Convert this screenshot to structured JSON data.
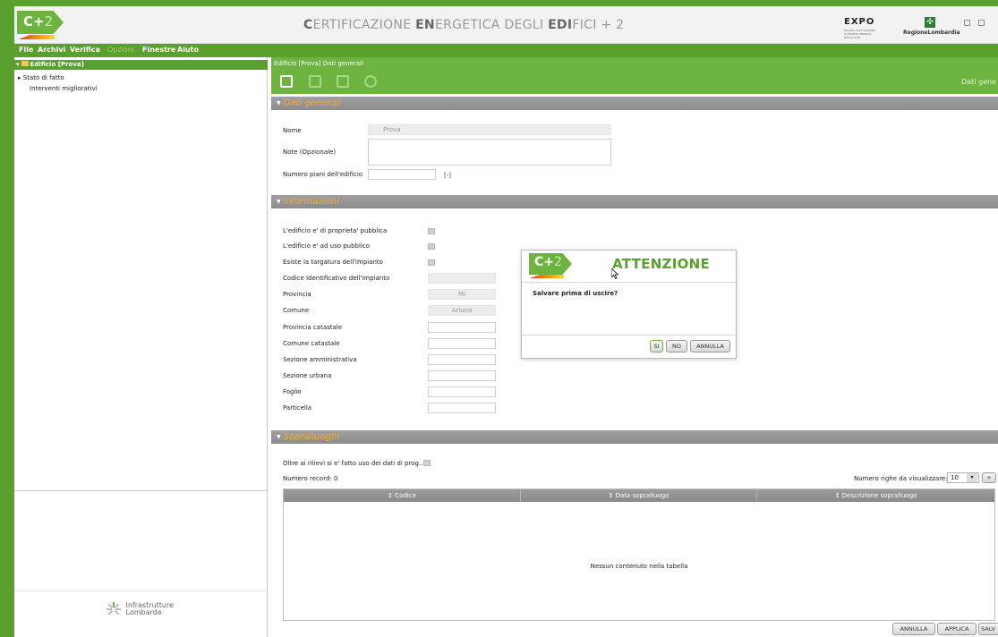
{
  "header": {
    "logo_main": "C+",
    "logo_sup": "2",
    "title_parts": [
      {
        "text": "C",
        "bold": true
      },
      {
        "text": "ERTIFICAZIONE ",
        "bold": false
      },
      {
        "text": "EN",
        "bold": true
      },
      {
        "text": "ERGETICA DEGLI ",
        "bold": false
      },
      {
        "text": "EDI",
        "bold": true
      },
      {
        "text": "FICI + 2",
        "bold": false
      }
    ],
    "expo_label": "EXPO",
    "expo_sub": "MILANO 2015 NUTRIRE IL PIANETA ENERGIA PER LA VITA",
    "region_label": "RegioneLombardia"
  },
  "menu": [
    {
      "label": "File",
      "enabled": true
    },
    {
      "label": "Archivi",
      "enabled": true
    },
    {
      "label": "Verifica",
      "enabled": true
    },
    {
      "label": "Opzioni",
      "enabled": false
    },
    {
      "label": "Finestre",
      "enabled": true
    },
    {
      "label": "Aiuto",
      "enabled": true
    }
  ],
  "tree": {
    "root": "Edificio [Prova]",
    "children": [
      "Stato di fatto",
      "Interventi migliorativi"
    ]
  },
  "footer_logo": {
    "line1": "Infrastrutture",
    "line2": "Lombarde"
  },
  "breadcrumb": "Edificio [Prova]   Dati generali",
  "toolbar": {
    "right_label": "Dati gene"
  },
  "dati_generali": {
    "title": "Dati generali",
    "nome_label": "Nome",
    "nome_value": "Prova",
    "note_label": "Note (Opzionale)",
    "piani_label": "Numero piani dell'edificio",
    "piani_unit": "[-]"
  },
  "informazioni": {
    "title": "Informazioni",
    "rows": [
      {
        "label": "L'edificio e' di proprieta' pubblica",
        "type": "check"
      },
      {
        "label": "L'edificio e' ad uso pubblico",
        "type": "check"
      },
      {
        "label": "Esiste la targatura dell'impianto",
        "type": "check"
      },
      {
        "label": "Codice Identificativo dell'impianto",
        "type": "readonly",
        "value": ""
      },
      {
        "label": "Provincia",
        "type": "readonly",
        "value": "MI"
      },
      {
        "label": "Comune",
        "type": "readonly",
        "value": "Arluno"
      },
      {
        "label": "Provincia catastale",
        "type": "input",
        "value": ""
      },
      {
        "label": "Comune catastale",
        "type": "input",
        "value": ""
      },
      {
        "label": "Sezione amministrativa",
        "type": "input",
        "value": ""
      },
      {
        "label": "Sezione urbana",
        "type": "input",
        "value": ""
      },
      {
        "label": "Foglio",
        "type": "input",
        "value": ""
      },
      {
        "label": "Particella",
        "type": "input",
        "value": ""
      }
    ]
  },
  "sopralluoghi": {
    "title": "Sopralluoghi",
    "rilievi_label": "Oltre ai rilievi si e' fatto uso dei dati di prog...",
    "record_label": "Numero record: 0",
    "rows_label": "Numero righe da visualizzare:",
    "rows_value": "10",
    "columns": [
      "↕ Codice",
      "↕ Data sopralluogo",
      "↕ Descrizione sopralluogo"
    ],
    "empty": "Nessun contenuto nella tabella"
  },
  "bottom_buttons": [
    "ANNULLA",
    "APPLICA",
    "SALV"
  ],
  "dialog": {
    "title": "ATTENZIONE",
    "message": "Salvare prima di uscire?",
    "buttons": [
      "SI",
      "NO",
      "ANNULLA"
    ]
  },
  "colors": {
    "brand_green": "#5aa02c",
    "toolbar_green": "#6db33f",
    "section_title": "#f9a825"
  }
}
